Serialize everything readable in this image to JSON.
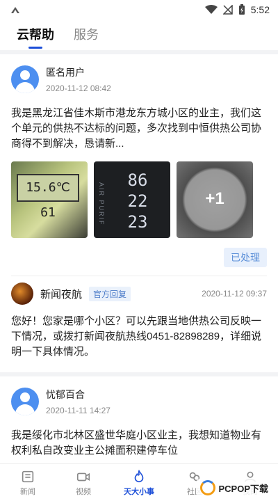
{
  "status_bar": {
    "time": "5:52"
  },
  "tabs": [
    {
      "label": "云帮助",
      "active": true
    },
    {
      "label": "服务",
      "active": false
    }
  ],
  "post1": {
    "username": "匿名用户",
    "time": "2020-11-12 08:42",
    "text": "我是黑龙江省佳木斯市港龙东方城小区的业主，我们这个单元的供热不达标的问题，多次找到中恒供热公司协商得不到解决，恳请新...",
    "images": [
      {
        "icon": "thermometer-photo-1",
        "display": "15.6℃ 61"
      },
      {
        "icon": "air-purifier-display-photo",
        "display": "86 22 23",
        "side": "AIR PURIF"
      },
      {
        "icon": "hygrometer-photo",
        "more": "+1"
      }
    ],
    "status": "已处理"
  },
  "reply1": {
    "name": "新闻夜航",
    "badge": "官方回复",
    "time": "2020-11-12 09:37",
    "text": "您好！您家是哪个小区？可以先跟当地供热公司反映一下情况，或拨打新闻夜航热线0451-82898289，详细说明一下具体情况。"
  },
  "post2": {
    "username": "忧郁百合",
    "time": "2020-11-11 14:27",
    "text": "我是绥化市北林区盛世华庭小区业主，我想知道物业有权利私自改变业主公摊面积建停车位"
  },
  "bottom_tabs": [
    {
      "label": "新闻",
      "icon": "newspaper-icon",
      "active": false
    },
    {
      "label": "视频",
      "icon": "video-camera-icon",
      "active": false
    },
    {
      "label": "天大小事",
      "icon": "flame-icon",
      "active": true
    },
    {
      "label": "社区",
      "icon": "community-icon",
      "active": false
    },
    {
      "label": "我的",
      "icon": "user-icon",
      "active": false
    }
  ],
  "watermark": {
    "text": "PCPOP下载"
  },
  "colors": {
    "accent": "#1d4fd8",
    "status_badge_bg": "#e8f0fc",
    "status_badge_text": "#5b8fd8"
  }
}
